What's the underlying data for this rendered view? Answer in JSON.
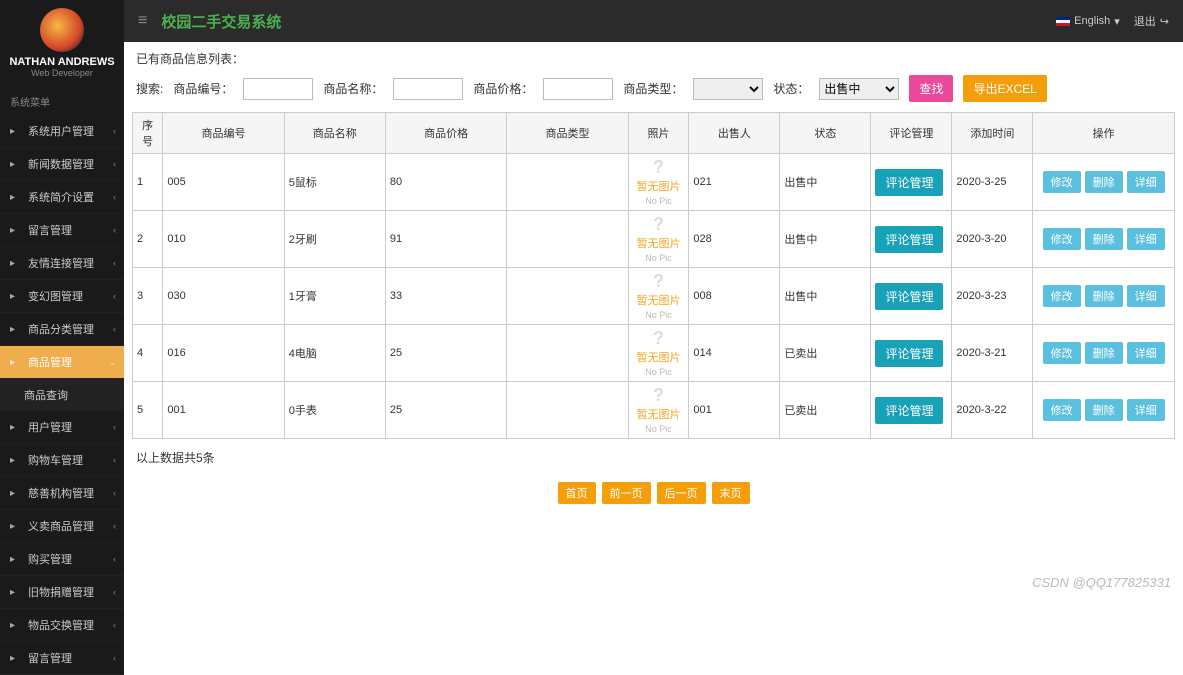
{
  "user": {
    "name": "NATHAN ANDREWS",
    "role": "Web Developer"
  },
  "app_title": "校园二手交易系统",
  "lang": {
    "label": "English"
  },
  "logout": "退出",
  "menu_header": "系统菜单",
  "menu": [
    {
      "label": "系统用户管理"
    },
    {
      "label": "新闻数据管理"
    },
    {
      "label": "系统简介设置"
    },
    {
      "label": "留言管理"
    },
    {
      "label": "友情连接管理"
    },
    {
      "label": "变幻图管理"
    },
    {
      "label": "商品分类管理"
    },
    {
      "label": "商品管理",
      "active": true,
      "arrow": "v"
    },
    {
      "label": "商品查询",
      "sub": true
    },
    {
      "label": "用户管理"
    },
    {
      "label": "购物车管理"
    },
    {
      "label": "慈善机构管理"
    },
    {
      "label": "义卖商品管理"
    },
    {
      "label": "购买管理"
    },
    {
      "label": "旧物捐赠管理"
    },
    {
      "label": "物品交换管理"
    },
    {
      "label": "留言管理"
    }
  ],
  "list_title": "已有商品信息列表：",
  "search": {
    "prefix": "搜索:",
    "id_label": "商品编号：",
    "name_label": "商品名称：",
    "price_label": "商品价格：",
    "type_label": "商品类型：",
    "status_label": "状态：",
    "status_value": "出售中",
    "find_btn": "查找",
    "export_btn": "导出EXCEL"
  },
  "columns": {
    "idx": "序号",
    "pid": "商品编号",
    "pname": "商品名称",
    "price": "商品价格",
    "ptype": "商品类型",
    "photo": "照片",
    "seller": "出售人",
    "status": "状态",
    "comment": "评论管理",
    "addtime": "添加时间",
    "ops": "操作"
  },
  "nopic": {
    "ch": "暂无图片",
    "en": "No Pic"
  },
  "rows": [
    {
      "idx": "1",
      "pid": "005",
      "pname": "5鼠标",
      "price": "80",
      "ptype": "",
      "seller": "021",
      "status": "出售中",
      "addtime": "2020-3-25"
    },
    {
      "idx": "2",
      "pid": "010",
      "pname": "2牙刷",
      "price": "91",
      "ptype": "",
      "seller": "028",
      "status": "出售中",
      "addtime": "2020-3-20"
    },
    {
      "idx": "3",
      "pid": "030",
      "pname": "1牙膏",
      "price": "33",
      "ptype": "",
      "seller": "008",
      "status": "出售中",
      "addtime": "2020-3-23"
    },
    {
      "idx": "4",
      "pid": "016",
      "pname": "4电脑",
      "price": "25",
      "ptype": "",
      "seller": "014",
      "status": "已卖出",
      "addtime": "2020-3-21"
    },
    {
      "idx": "5",
      "pid": "001",
      "pname": "0手表",
      "price": "25",
      "ptype": "",
      "seller": "001",
      "status": "已卖出",
      "addtime": "2020-3-22"
    }
  ],
  "row_btns": {
    "comment": "评论管理",
    "edit": "修改",
    "del": "删除",
    "detail": "详细"
  },
  "footer_note": "以上数据共5条",
  "pager": {
    "first": "首页",
    "prev": "前一页",
    "next": "后一页",
    "last": "末页"
  },
  "watermark": "CSDN @QQ177825331"
}
